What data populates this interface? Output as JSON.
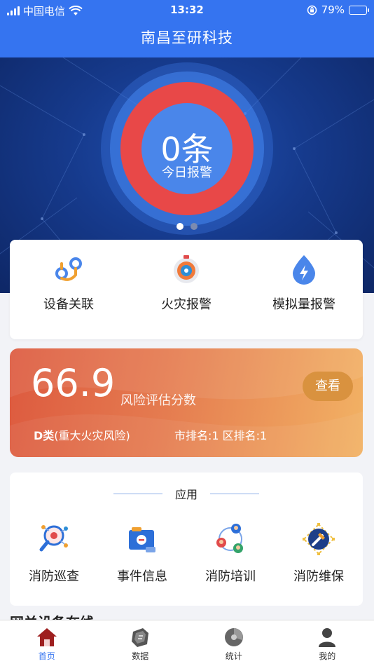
{
  "status": {
    "carrier": "中国电信",
    "time": "13:32",
    "battery": "79%",
    "battery_level": 0.79
  },
  "header": {
    "title": "南昌至研科技"
  },
  "banner": {
    "count": "0条",
    "label": "今日报警",
    "page": 1,
    "pages": 2
  },
  "quick_actions": [
    {
      "label": "设备关联",
      "icon": "device-link-icon"
    },
    {
      "label": "火灾报警",
      "icon": "fire-alarm-icon"
    },
    {
      "label": "模拟量报警",
      "icon": "analog-alarm-icon"
    }
  ],
  "risk": {
    "score": "66.9",
    "score_label": "风险评估分数",
    "view_label": "查看",
    "grade": "D类",
    "grade_desc": "(重大火灾风险)",
    "rank": "市排名:1 区排名:1"
  },
  "apps": {
    "title": "应用",
    "items": [
      {
        "label": "消防巡查",
        "icon": "inspection-icon"
      },
      {
        "label": "事件信息",
        "icon": "event-info-icon"
      },
      {
        "label": "消防培训",
        "icon": "training-icon"
      },
      {
        "label": "消防维保",
        "icon": "maintenance-icon"
      }
    ]
  },
  "next_section": {
    "title": "网关设备在线"
  },
  "tabs": [
    {
      "label": "首页",
      "icon": "home-icon",
      "active": true
    },
    {
      "label": "数据",
      "icon": "data-icon",
      "active": false
    },
    {
      "label": "统计",
      "icon": "stats-icon",
      "active": false
    },
    {
      "label": "我的",
      "icon": "profile-icon",
      "active": false
    }
  ],
  "colors": {
    "primary": "#3574f0",
    "alarm_ring": "#e84848",
    "risk_start": "#dd5a3f",
    "risk_end": "#f2b264"
  }
}
